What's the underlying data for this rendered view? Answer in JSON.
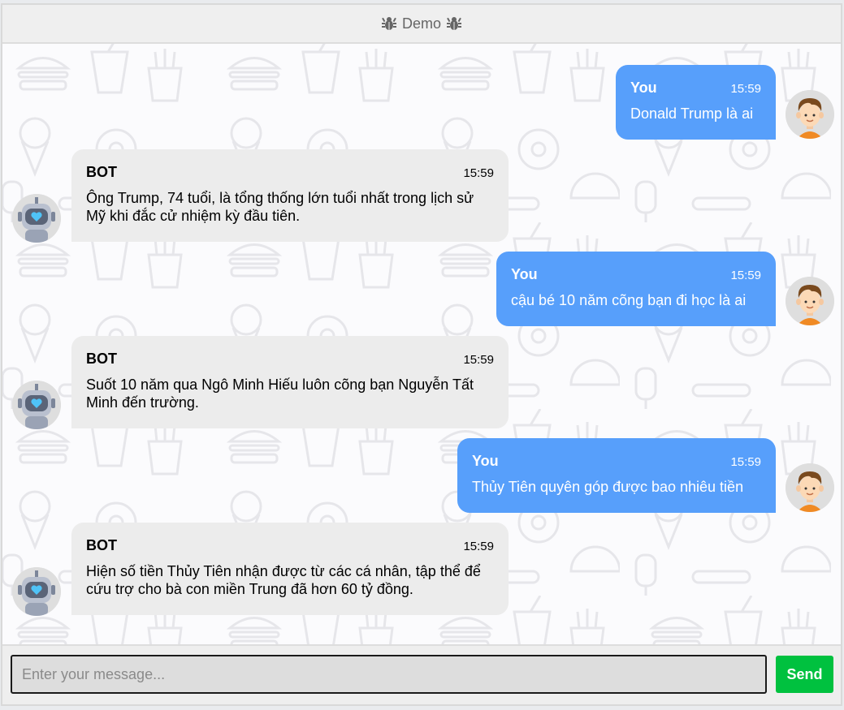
{
  "header": {
    "title": "Demo",
    "icon": "bug-icon"
  },
  "messages": [
    {
      "sender": "You",
      "time": "15:59",
      "text": "Donald Trump là ai",
      "side": "user"
    },
    {
      "sender": "BOT",
      "time": "15:59",
      "text": "Ông Trump, 74 tuổi, là tổng thống lớn tuổi nhất trong lịch sử Mỹ khi đắc cử nhiệm kỳ đầu tiên.",
      "side": "bot"
    },
    {
      "sender": "You",
      "time": "15:59",
      "text": "cậu bé 10 năm cõng bạn đi học là ai",
      "side": "user"
    },
    {
      "sender": "BOT",
      "time": "15:59",
      "text": "Suốt 10 năm qua Ngô Minh Hiếu luôn cõng bạn Nguyễn Tất Minh đến trường.",
      "side": "bot"
    },
    {
      "sender": "You",
      "time": "15:59",
      "text": "Thủy Tiên quyên góp được bao nhiêu tiền",
      "side": "user"
    },
    {
      "sender": "BOT",
      "time": "15:59",
      "text": "Hiện số tiền Thủy Tiên nhận được từ các cá nhân, tập thể để cứu trợ cho bà con miền Trung đã hơn 60 tỷ đồng.",
      "side": "bot"
    }
  ],
  "input": {
    "placeholder": "Enter your message...",
    "value": ""
  },
  "send_button": {
    "label": "Send"
  },
  "colors": {
    "user_bubble": "#579ffb",
    "bot_bubble": "#ececec",
    "send_button": "#00c13f"
  }
}
